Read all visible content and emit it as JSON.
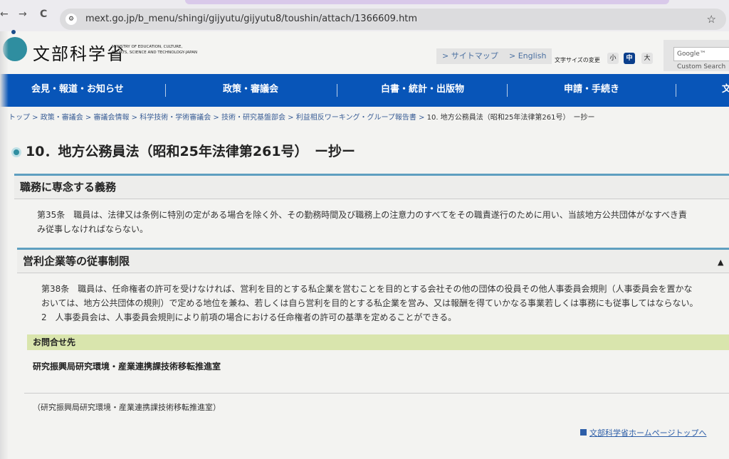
{
  "browser": {
    "url": "mext.go.jp/b_menu/shingi/gijyutu/gijyutu8/toushin/attach/1366609.htm",
    "back": "←",
    "forward": "→",
    "reload": "C"
  },
  "header": {
    "logo_text": "文部科学省",
    "logo_sub": "MINISTRY OF EDUCATION, CULTURE, SPORTS, SCIENCE AND TECHNOLOGY-JAPAN",
    "sitemap": "> サイトマップ",
    "english": "> English",
    "font_size_label": "文字サイズの変更",
    "font_small": "小",
    "font_medium": "中",
    "font_large": "大",
    "search_placeholder": "Google™ Custom Search"
  },
  "nav": {
    "items": [
      "会見・報道・お知らせ",
      "政策・審議会",
      "白書・統計・出版物",
      "申請・手続き",
      "文"
    ]
  },
  "breadcrumb": {
    "items": [
      "トップ",
      "政策・審議会",
      "審議会情報",
      "科学技術・学術審議会",
      "技術・研究基盤部会",
      "利益相反ワーキング・グループ報告書"
    ],
    "current": "10. 地方公務員法（昭和25年法律第261号）　ー抄ー"
  },
  "page": {
    "title": "10．地方公務員法（昭和25年法律第261号）　ー抄ー",
    "sections": [
      {
        "heading": "職務に専念する義務",
        "lines": [
          "第35条　職員は、法律又は条例に特別の定がある場合を除く外、その勤務時間及び職務上の注意力のすべてをその職責遂行のために用い、当該地方公共団体がなすべき責",
          "み従事しなければならない。"
        ]
      },
      {
        "heading": "営利企業等の従事制限",
        "lines": [
          "第38条　職員は、任命権者の許可を受けなければ、営利を目的とする私企業を営むことを目的とする会社その他の団体の役員その他人事委員会規則（人事委員会を置かな",
          "おいては、地方公共団体の規則）で定める地位を兼ね、若しくは自ら営利を目的とする私企業を営み、又は報酬を得ていかなる事業若しくは事務にも従事してはならない。",
          "2　人事委員会は、人事委員会規則により前項の場合における任命権者の許可の基準を定めることができる。"
        ]
      }
    ],
    "contact_heading": "お問合せ先",
    "contact_name": "研究振興局研究環境・産業連携課技術移転推進室",
    "contact_note": "（研究振興局研究環境・産業連携課技術移転推進室）",
    "top_link": "文部科学省ホームページトップへ"
  },
  "colors": {
    "nav": "#0855b8",
    "accent": "#2f8ea0",
    "contact_bg": "#d9e5ad"
  }
}
